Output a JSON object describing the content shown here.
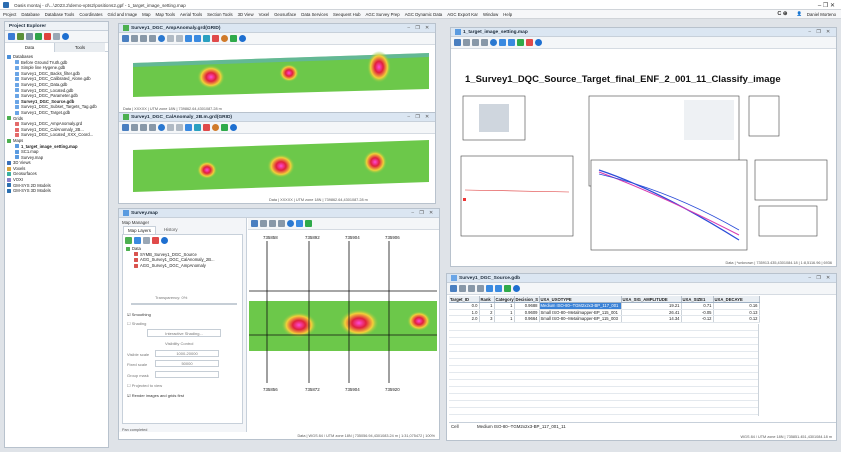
{
  "titlebar": {
    "title": "Oasis montaj - cl\\...\\2023.2\\demo-vpts2\\positions2.gpf - 1_target_image_setting.map",
    "controls": "–   ❐   ✕"
  },
  "menubar": {
    "items": [
      "Project",
      "Database",
      "Database Tools",
      "Coordinates",
      "Grid and Image",
      "Map",
      "Map Tools",
      "Aerial Tools",
      "Section Tools",
      "3D View",
      "Voxel",
      "Geosurface",
      "Data Services",
      "Seequent Hub",
      "AGC Survey Prep",
      "AGC Dynamic Data",
      "AGC Export Kar",
      "Window",
      "Help"
    ],
    "user": "Daniel Morteno"
  },
  "project_explorer": {
    "title": "Project Explorer",
    "tabs": [
      "Data",
      "Tools"
    ],
    "databases_header": "Databases",
    "databases": [
      "Before Ground Truth.gdb",
      "Simple line Hygene.gdb",
      "Survey1_DGC_Backs_filter.gdb",
      "Survey1_DGC_Calibrated_Alone.gdb",
      "Survey1_DGC_Data.gdb",
      "Survey1_DGC_Located.gdb",
      "Survey1_DGC_Parameter.gdb",
      "Survey1_DGC_Source.gdb",
      "Survey1_DGC_Subset_Targets_Tag.gdb",
      "Survey1_DGC_Target.gdb"
    ],
    "grids_header": "Grids",
    "grids": [
      "Survey1_DGC_AmpAnomaly.grd",
      "Survey1_DGC_CalAnomaly_2B...",
      "Survey1_DGC_Located_XXX_Coord..."
    ],
    "maps_header": "Maps",
    "maps": [
      "1_target_image_setting.map",
      "SC1.map",
      "Survey.map"
    ],
    "others": [
      "3D Views",
      "Voxels",
      "Geosurfaces",
      "VOXI",
      "GM-SYS 2D Models",
      "GM-SYS 3D Models"
    ]
  },
  "grid_windows": [
    {
      "title": "Survey1_DGC_AmpAnomaly.grd(GRID)",
      "status": "Data | XXXXX | UTM zone 18N | 739862.64,4301087.28 m"
    },
    {
      "title": "Survey1_DGC_CalAnomaly_2B.m.grd(GRID)",
      "status": "Data | XXXXX | UTM zone 18N | 739862.64,4301087.28 m"
    }
  ],
  "survey_map": {
    "title": "Survey.map",
    "manager_title": "Map Manager",
    "tabs": [
      "Map Layers",
      "History"
    ],
    "layer_root": "Data",
    "layers": [
      "SYMB_Survey1_DGC_Source",
      "AGG_Survey1_DGC_CalAnomaly_2B...",
      "AGG_Survey1_DGC_AmpAnomaly"
    ],
    "transparency_label": "Transparency: 0%",
    "smoothing_label": "Smoothing",
    "shading_label": "Shading",
    "interactive_shading": "Interactive Shading...",
    "visibility_control": "Visibility Control",
    "visible_scale_label": "Visible scale",
    "visible_scale_value": "1000-20000",
    "fixed_scale_label": "Fixed scale",
    "fixed_scale_value": "50000",
    "group_mask_label": "Group mask",
    "projected_view": "Projected to view",
    "render_option": "Render images and grids first",
    "x_ticks_top": [
      "735858",
      "735892",
      "735904",
      "735906"
    ],
    "x_ticks_bottom": [
      "735856",
      "735872",
      "735904",
      "735920"
    ],
    "status_left": "Pan completed",
    "status_right": "Data | WGS 84 / UTM zone 18N | 735056.94,4301083.24 m | 1:31,075472 | 100%"
  },
  "target_map": {
    "title": "1_target_image_setting.map",
    "heading": "1_Survey1_DQC_Source_Target_final_ENF_2_001_11_Classify_image",
    "status": "Data | *unknown | 735913.435,4301084.18 | 1:8,5116.96 | 6936"
  },
  "database": {
    "title": "Survey1_DGC_Source.gdb",
    "columns": [
      "Target_ID",
      "Rank",
      "Category",
      "Decision_S",
      "UXA_UXOTYPE",
      "UXA_SIG_AMPLITUDE",
      "UXA_SIZE1",
      "UXA_DECAYE"
    ],
    "rows": [
      [
        "0.0",
        "1",
        "1",
        "0.9688",
        "Medium ISO-80--TGM2x2x3-BP_117_001",
        "19.21",
        "0.71",
        "0.16"
      ],
      [
        "1.0",
        "2",
        "1",
        "0.9609",
        "Small ISO-80--Metalmapper-BP_115_001",
        "26.41",
        "-0.05",
        "0.13"
      ],
      [
        "2.0",
        "3",
        "1",
        "0.9664",
        "Small ISO-80--Metalmapper-BP_115_003",
        "14.34",
        "-0.12",
        "0.12"
      ]
    ],
    "cell_label": "Cell",
    "cell_value": "Medium ISO-80--TGM2x2x3-BP_117_001_11",
    "status": "WGS 84 / UTM zone 18N | 735851.451,4301084.18 m"
  },
  "colors": {
    "accent": "#0a64c8",
    "grid_green": "#6cc84a",
    "anomaly_red": "#e0203c",
    "anomaly_magenta": "#d82ad8"
  }
}
